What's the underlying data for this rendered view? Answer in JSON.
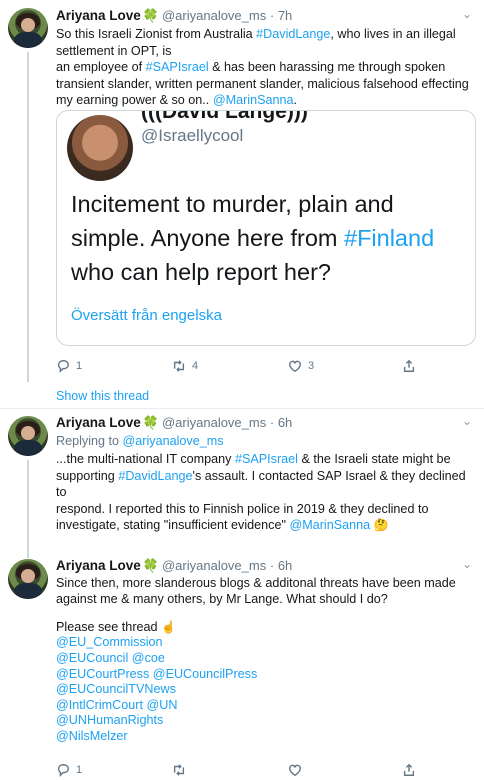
{
  "tweets": [
    {
      "name": "Ariyana Love",
      "badge": "🍀",
      "handle": "@ariyanalove_ms",
      "dot": "·",
      "time": "7h",
      "text_lines": [
        [
          "So this Israeli Zionist from Australia ",
          {
            "link": "#DavidLange"
          },
          ", who lives in an illegal"
        ],
        [
          "settlement in OPT, is"
        ],
        [
          "an employee of ",
          {
            "link": "#SAPIsrael"
          },
          " & has been harassing me through spoken"
        ],
        [
          "transient slander, written permanent slander, malicious falsehood effecting"
        ],
        [
          "my earning power & so on.. ",
          {
            "link": "@MarinSanna"
          },
          "."
        ]
      ],
      "quote": {
        "handle_cut": "(((David Lange)))",
        "handle": "@Israellycool",
        "text": "Incitement to murder, plain and simple. Anyone here from ",
        "text_link": "#Finland",
        "text_end": " who can help report her?",
        "translate": "Översätt från engelska"
      },
      "actions": {
        "reply": "1",
        "retweet": "4",
        "like": "3",
        "share": ""
      }
    },
    {
      "show_thread": "Show this thread"
    },
    {
      "name": "Ariyana Love",
      "badge": "🍀",
      "handle": "@ariyanalove_ms",
      "dot": "·",
      "time": "6h",
      "reply_label": "Replying to ",
      "reply_to": "@ariyanalove_ms",
      "text_lines": [
        [
          "...the multi-national IT company ",
          {
            "link": "#SAPIsrael"
          },
          " & the Israeli state might be"
        ],
        [
          "supporting ",
          {
            "link": "#DavidLange"
          },
          "'s assault. I contacted SAP Israel & they declined to"
        ],
        [
          "respond. I reported this to Finnish police in 2019 & they declined to"
        ],
        [
          "investigate, stating \"insufficient evidence\" ",
          {
            "link": "@MarinSanna"
          },
          " ",
          {
            "emoji": "🤔"
          }
        ]
      ]
    },
    {
      "name": "Ariyana Love",
      "badge": "🍀",
      "handle": "@ariyanalove_ms",
      "dot": "·",
      "time": "6h",
      "text_lines": [
        [
          "Since then, more slanderous blogs & additonal threats have been made"
        ],
        [
          "against me & many others, by Mr Lange. What should I do?"
        ],
        [
          ""
        ],
        [
          "Please see thread ",
          {
            "emoji": "☝️"
          }
        ],
        [
          {
            "link": "@EU_Commission"
          }
        ],
        [
          {
            "link": "@EUCouncil"
          },
          " ",
          {
            "link": "@coe"
          }
        ],
        [
          {
            "link": "@EUCourtPress"
          },
          " ",
          {
            "link": "@EUCouncilPress"
          }
        ],
        [
          {
            "link": "@EUCouncilTVNews"
          }
        ],
        [
          {
            "link": "@IntlCrimCourt"
          },
          " ",
          {
            "link": "@UN"
          }
        ],
        [
          {
            "link": "@UNHumanRights"
          }
        ],
        [
          {
            "link": "@NilsMelzer"
          }
        ]
      ],
      "actions": {
        "reply": "1",
        "retweet": "",
        "like": "",
        "share": ""
      }
    }
  ],
  "colors": {
    "link": "#1da1f2",
    "muted": "#657786",
    "text": "#14171a",
    "border": "#ccd6dd"
  },
  "icons": {
    "reply": "reply-icon",
    "retweet": "retweet-icon",
    "like": "heart-icon",
    "share": "share-icon",
    "caret": "chevron-down-icon"
  }
}
